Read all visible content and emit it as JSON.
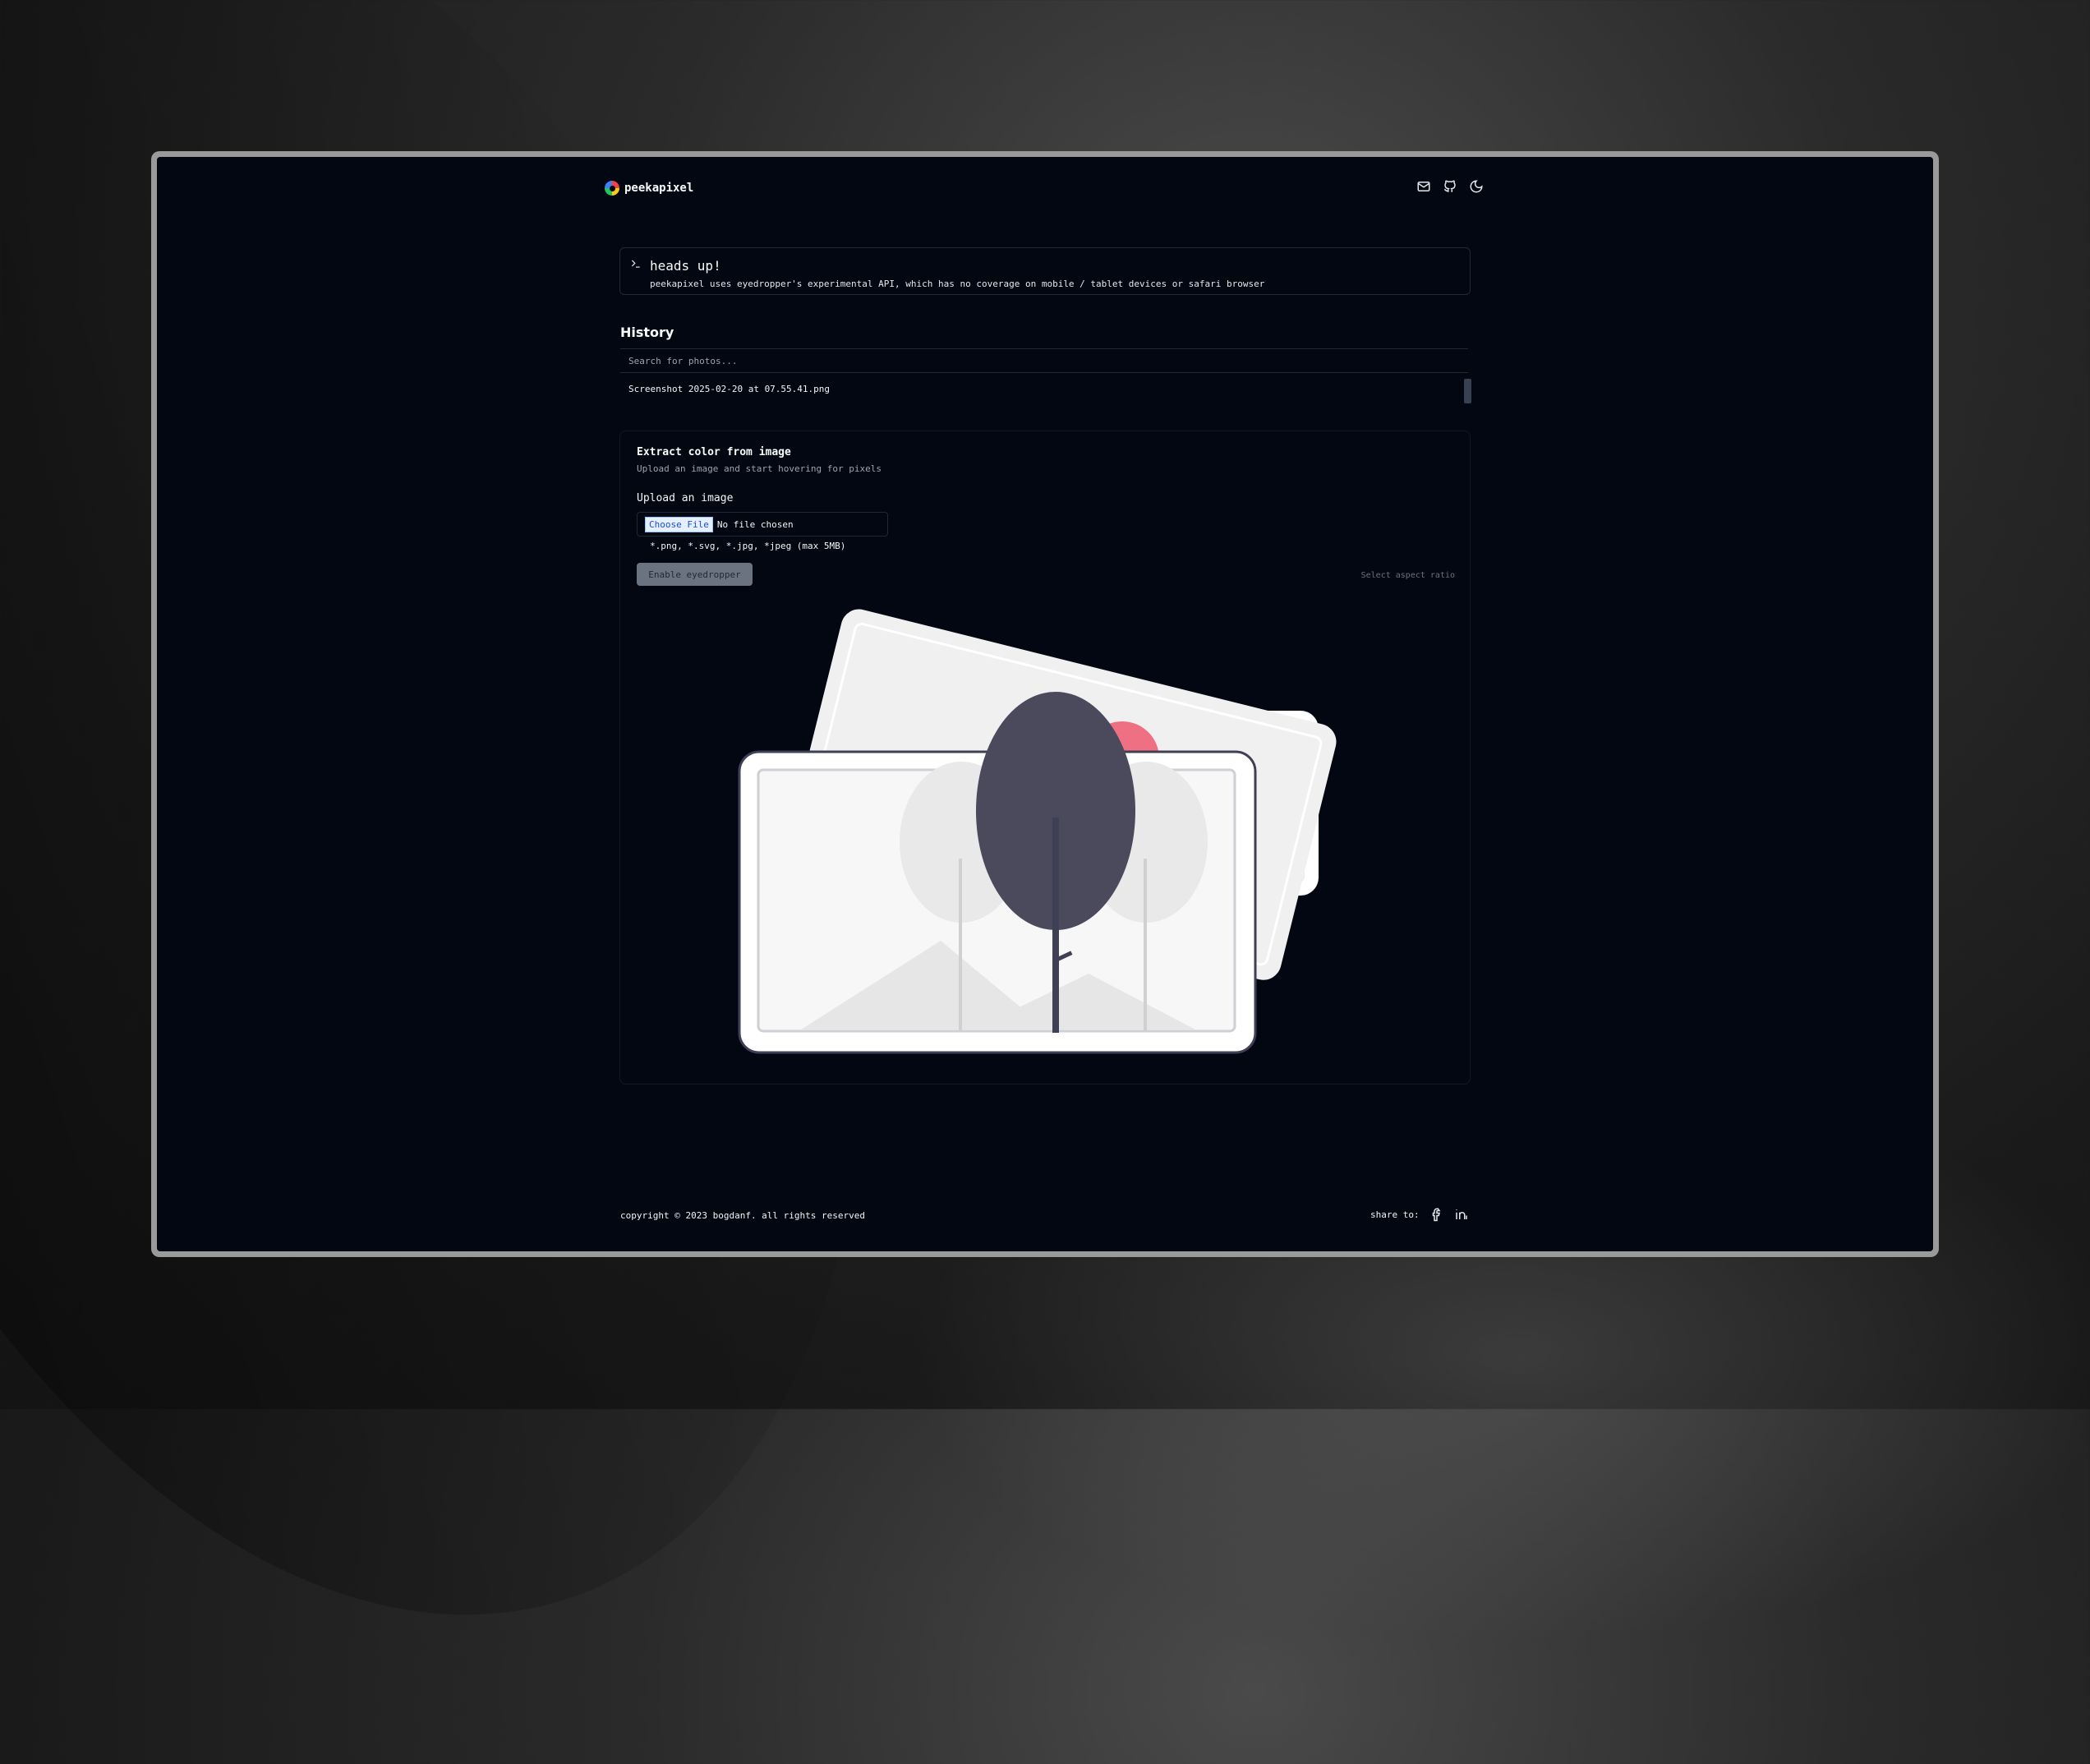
{
  "app": {
    "name": "peekapixel"
  },
  "header": {
    "icons": [
      "mail-icon",
      "github-icon",
      "moon-icon"
    ]
  },
  "alert": {
    "title": "heads up!",
    "description": "peekapixel uses eyedropper's experimental API, which has no coverage on mobile / tablet devices or safari browser"
  },
  "history": {
    "title": "History",
    "search_placeholder": "Search for photos...",
    "items": [
      "Screenshot 2025-02-20 at 07.55.41.png"
    ]
  },
  "extract": {
    "title": "Extract color from image",
    "description": "Upload an image and start hovering for pixels",
    "upload_label": "Upload an image",
    "choose_file": "Choose File",
    "no_file": "No file chosen",
    "hint": "*.png, *.svg, *.jpg, *jpeg (max 5MB)",
    "eyedropper_button": "Enable eyedropper",
    "aspect_placeholder": "Select aspect ratio"
  },
  "footer": {
    "copyright": "copyright © 2023 bogdanf. all rights reserved",
    "share_label": "share to:",
    "share_icons": [
      "facebook-icon",
      "linkedin-icon"
    ]
  },
  "colors": {
    "background": "#030712",
    "accent_red": "#f07083",
    "tree": "#4b4a5c"
  }
}
